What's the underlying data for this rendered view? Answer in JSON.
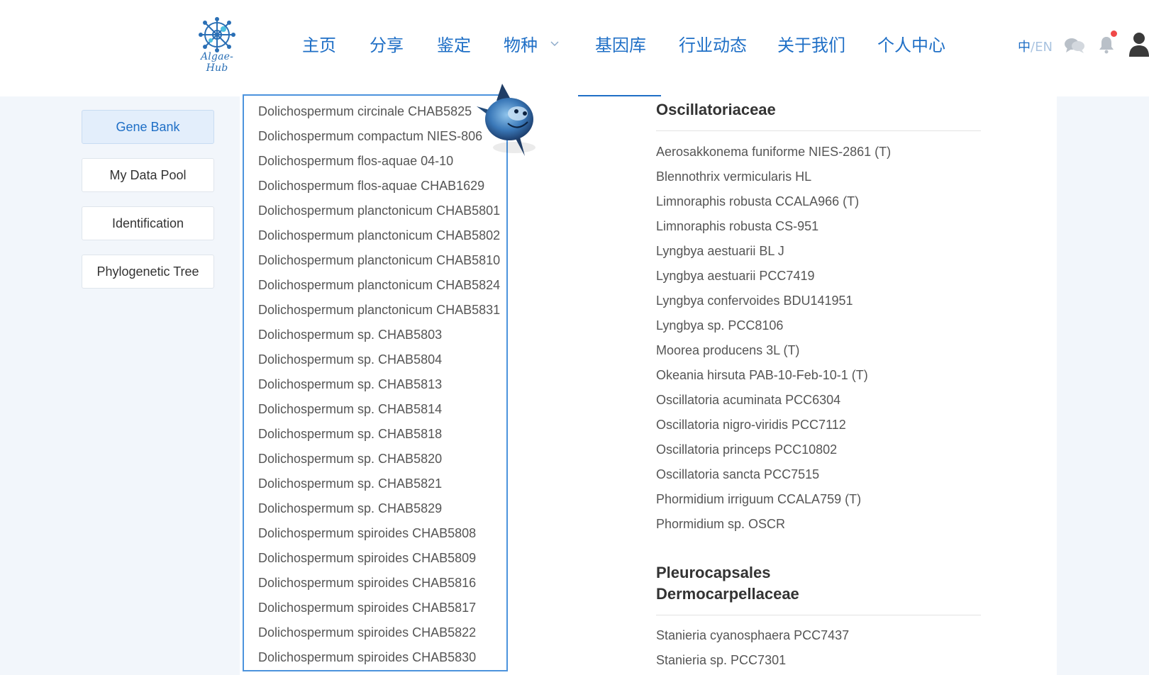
{
  "header": {
    "logo_text": "Algae-Hub",
    "nav": [
      {
        "label": "主页"
      },
      {
        "label": "分享"
      },
      {
        "label": "鉴定"
      },
      {
        "label": "物种"
      },
      {
        "label": "基因库"
      },
      {
        "label": "行业动态"
      },
      {
        "label": "关于我们"
      },
      {
        "label": "个人中心"
      }
    ],
    "lang": {
      "zh": "中",
      "sep": "/",
      "en": "EN"
    },
    "icons": [
      "chat-icon",
      "bell-icon",
      "user-icon"
    ],
    "accent_color": "#1f6fc6"
  },
  "sidebar": {
    "items": [
      {
        "label": "Gene Bank",
        "active": true
      },
      {
        "label": "My Data Pool"
      },
      {
        "label": "Identification"
      },
      {
        "label": "Phylogenetic Tree"
      }
    ]
  },
  "dropdown": {
    "items": [
      "Dolichospermum circinale CHAB5825",
      "Dolichospermum compactum NIES-806",
      "Dolichospermum flos-aquae 04-10",
      "Dolichospermum flos-aquae CHAB1629",
      "Dolichospermum planctonicum CHAB5801",
      "Dolichospermum planctonicum CHAB5802",
      "Dolichospermum planctonicum CHAB5810",
      "Dolichospermum planctonicum CHAB5824",
      "Dolichospermum planctonicum CHAB5831",
      "Dolichospermum sp. CHAB5803",
      "Dolichospermum sp. CHAB5804",
      "Dolichospermum sp. CHAB5813",
      "Dolichospermum sp. CHAB5814",
      "Dolichospermum sp. CHAB5818",
      "Dolichospermum sp. CHAB5820",
      "Dolichospermum sp. CHAB5821",
      "Dolichospermum sp. CHAB5829",
      "Dolichospermum spiroides CHAB5808",
      "Dolichospermum spiroides CHAB5809",
      "Dolichospermum spiroides CHAB5816",
      "Dolichospermum spiroides CHAB5817",
      "Dolichospermum spiroides CHAB5822",
      "Dolichospermum spiroides CHAB5830"
    ]
  },
  "content": {
    "families": [
      {
        "title": "Oscillatoriaceae",
        "strains": [
          "Aerosakkonema funiforme NIES-2861 (T)",
          "Blennothrix vermicularis HL",
          "Limnoraphis robusta CCALA966 (T)",
          "Limnoraphis robusta CS-951",
          "Lyngbya aestuarii BL J",
          "Lyngbya aestuarii PCC7419",
          "Lyngbya confervoides BDU141951",
          "Lyngbya sp. PCC8106",
          "Moorea producens 3L (T)",
          "Okeania hirsuta PAB-10-Feb-10-1 (T)",
          "Oscillatoria acuminata PCC6304",
          "Oscillatoria nigro-viridis PCC7112",
          "Oscillatoria princeps PCC10802",
          "Oscillatoria sancta PCC7515",
          "Phormidium irriguum CCALA759 (T)",
          "Phormidium sp. OSCR"
        ]
      },
      {
        "title_line1": "Pleurocapsales",
        "title_line2": "Dermocarpellaceae",
        "strains": [
          "Stanieria cyanosphaera PCC7437",
          "Stanieria sp. PCC7301"
        ]
      }
    ]
  }
}
